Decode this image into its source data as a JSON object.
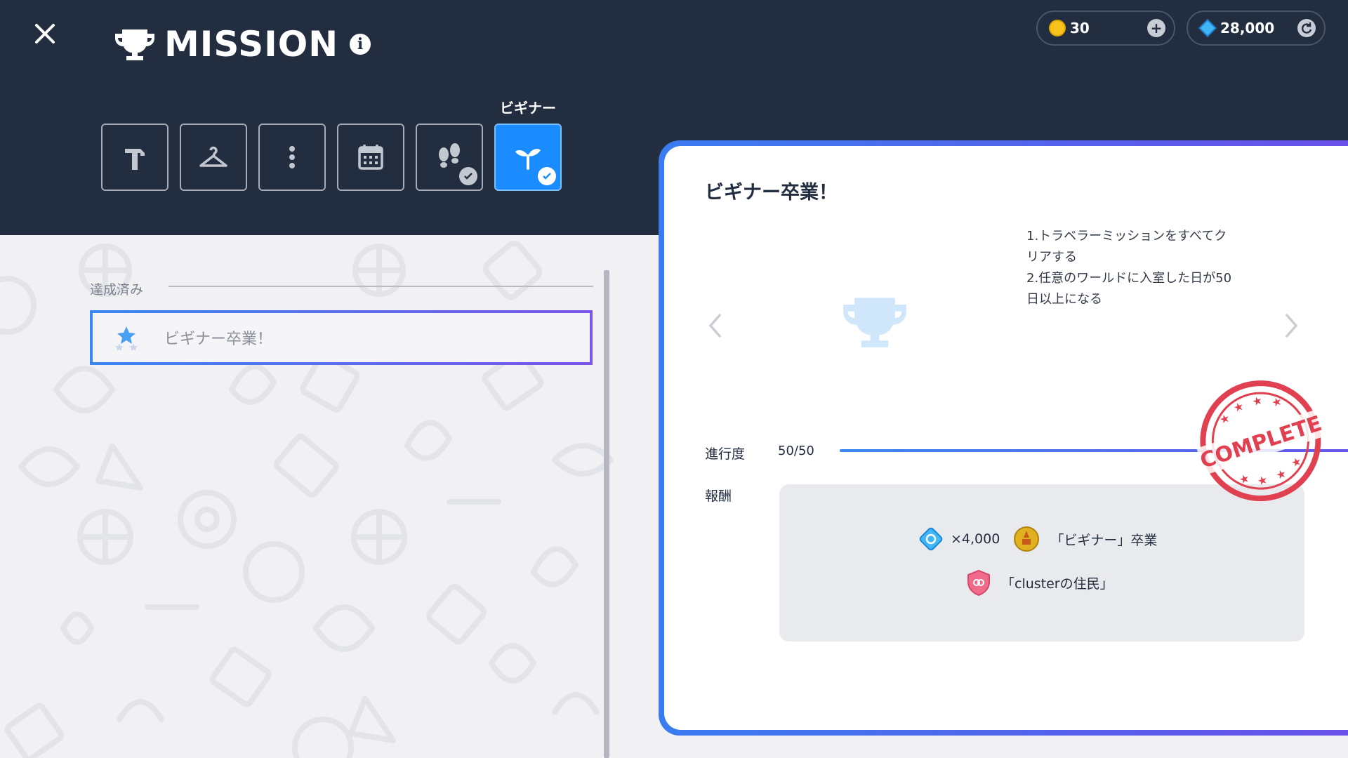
{
  "header": {
    "title": "MISSION",
    "info_icon": "i",
    "currency_coin": {
      "value": "30",
      "icon": "coin-icon",
      "action": "+"
    },
    "currency_gem": {
      "value": "28,000",
      "icon": "gem-icon",
      "action": "refresh"
    },
    "active_category_label": "ビギナー"
  },
  "tabs": [
    {
      "icon": "hammer-icon",
      "active": false
    },
    {
      "icon": "hanger-icon",
      "active": false
    },
    {
      "icon": "more-icon",
      "active": false
    },
    {
      "icon": "calendar-icon",
      "active": false
    },
    {
      "icon": "footprints-icon",
      "active": false,
      "completed": true
    },
    {
      "icon": "sprout-icon",
      "active": true,
      "completed": true
    }
  ],
  "list": {
    "section_label": "達成済み",
    "items": [
      {
        "label": "ビギナー卒業！",
        "icon": "star-icon"
      }
    ]
  },
  "detail": {
    "title": "ビギナー卒業！",
    "description_lines": [
      "1.トラベラーミッションをすべてク",
      "リアする",
      "2.任意のワールドに入室した日が50",
      "日以上になる"
    ],
    "progress_label": "進行度",
    "progress_value": "50/50",
    "progress_fraction": 1.0,
    "reward_label": "報酬",
    "rewards": [
      {
        "text": "×4,000",
        "icon": "gem-icon"
      },
      {
        "text": "「ビギナー」卒業",
        "icon": "medal-icon"
      },
      {
        "text": "「clusterの住民」",
        "icon": "shield-badge-icon"
      }
    ],
    "stamp_text": "COMPLETE"
  },
  "colors": {
    "header_bg": "#222d40",
    "accent_blue": "#1a8cff",
    "accent_purple": "#6a55e8",
    "stamp_red": "#e0404f"
  }
}
